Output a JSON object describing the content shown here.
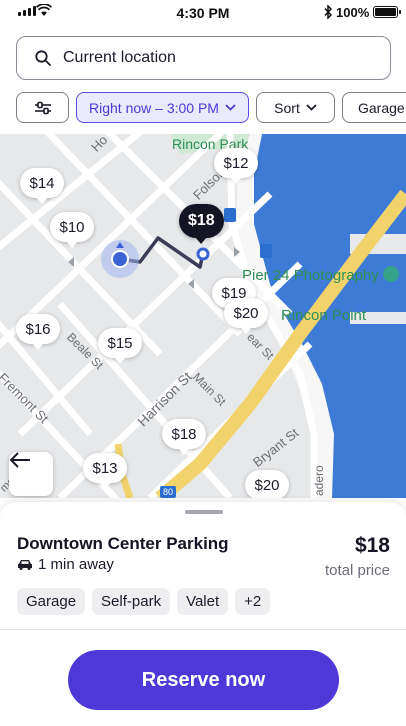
{
  "status_bar": {
    "time": "4:30 PM",
    "battery": "100%"
  },
  "search": {
    "label": "Current location"
  },
  "filters": {
    "time_label": "Right now – 3:00 PM",
    "sort_label": "Sort",
    "type_label": "Garage"
  },
  "map": {
    "pins": [
      "$12",
      "$14",
      "$10",
      "$18",
      "$19",
      "$20",
      "$16",
      "$15",
      "$18",
      "$13",
      "$20"
    ],
    "labels": {
      "rincon_park": "Rincon Park",
      "folsom": "Folsom St",
      "pier24": "Pier 24 Photography",
      "rincon_point": "Rincon Point",
      "beale": "Beale St",
      "fremont": "Fremont St",
      "harrison": "Harrison St",
      "main": "Main St",
      "bryant": "Bryant St",
      "spear": "ear St",
      "howard": "Ho",
      "embarcadero": "adero",
      "hwy": "80",
      "mont": "mont"
    }
  },
  "lot": {
    "name": "Downtown Center Parking",
    "distance": "1 min away",
    "price": "$18",
    "price_caption": "total price",
    "tags": [
      "Garage",
      "Self-park",
      "Valet",
      "+2"
    ]
  },
  "cta": {
    "label": "Reserve now"
  },
  "colors": {
    "accent": "#4f38d8",
    "selected_pin": "#151425",
    "water": "#3e7bd6",
    "highway": "#f2d36b"
  }
}
